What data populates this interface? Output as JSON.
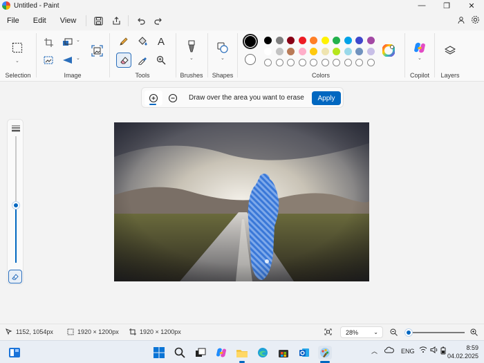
{
  "window": {
    "title": "Untitled - Paint",
    "minimize_glyph": "—",
    "restore_glyph": "❐",
    "close_glyph": "✕"
  },
  "menu": {
    "file": "File",
    "edit": "Edit",
    "view": "View"
  },
  "ribbon": {
    "groups": {
      "selection": "Selection",
      "image": "Image",
      "tools": "Tools",
      "brushes": "Brushes",
      "shapes": "Shapes",
      "colors": "Colors",
      "copilot": "Copilot",
      "layers": "Layers"
    },
    "text_tool_glyph": "A",
    "primary_color": "#000000",
    "secondary_color": "#ffffff",
    "palette_row1": [
      "#000000",
      "#7f7f7f",
      "#880015",
      "#ed1c24",
      "#ff7f27",
      "#fff200",
      "#22b14c",
      "#00a2e8",
      "#3f48cc",
      "#a349a4"
    ],
    "palette_row2": [
      "#ffffff",
      "#c3c3c3",
      "#b97a57",
      "#ffaec9",
      "#ffc90e",
      "#efe4b0",
      "#b5e61d",
      "#99d9ea",
      "#7092be",
      "#c8bfe7"
    ]
  },
  "erase_bar": {
    "instruction": "Draw over the area you want to erase",
    "apply_label": "Apply"
  },
  "status": {
    "cursor_position": "1152, 1054px",
    "selection_size": "1920 × 1200px",
    "canvas_size": "1920 × 1200px",
    "zoom": "28%"
  },
  "taskbar": {
    "language": "ENG",
    "time": "8:59",
    "date": "04.02.2025"
  }
}
